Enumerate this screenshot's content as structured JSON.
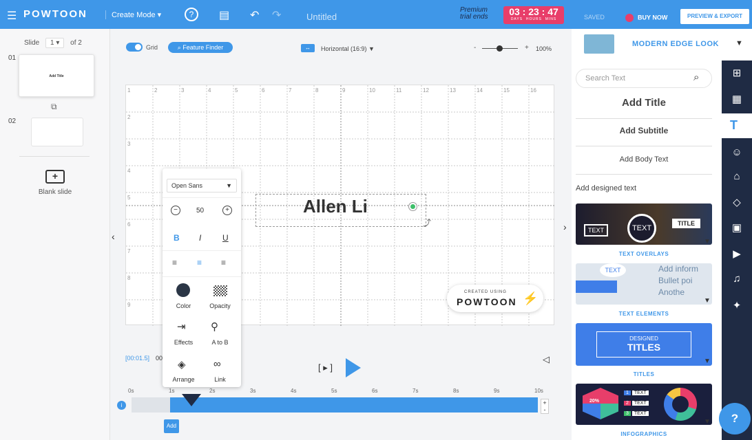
{
  "topbar": {
    "brand": "POWTOON",
    "mode_label": "Create Mode ▾",
    "doc_title": "Untitled",
    "premium_line1": "Premium",
    "premium_line2": "trial ends",
    "timer_value": "03 : 23 : 47",
    "timer_days": "DAYS",
    "timer_hours": "HOURS",
    "timer_mins": "MINS",
    "saved_label": "SAVED",
    "buy_label": "BUY NOW",
    "export_label": "PREVIEW & EXPORT"
  },
  "toolbar": {
    "grid_label": "Grid",
    "feature_finder": "Feature Finder",
    "orientation": "Horizontal (16:9)",
    "zoom": "100%",
    "zoom_minus": "-",
    "zoom_plus": "+"
  },
  "slides": {
    "slide_label": "Slide",
    "current": "1 ▾",
    "of_total": "of 2",
    "items": [
      {
        "num": "01",
        "title": "Add Title"
      },
      {
        "num": "02",
        "title": ""
      }
    ],
    "blank_label": "Blank slide"
  },
  "canvas": {
    "main_text": "Allen Li",
    "watermark_small": "CREATED USING",
    "watermark_big": "POWTOON",
    "grid_cols": [
      "1",
      "2",
      "3",
      "4",
      "5",
      "6",
      "7",
      "8",
      "9",
      "10",
      "11",
      "12",
      "13",
      "14",
      "15",
      "16"
    ],
    "grid_rows": [
      "2",
      "3",
      "4",
      "5",
      "6",
      "7",
      "8",
      "9"
    ]
  },
  "textpanel": {
    "font": "Open Sans",
    "font_size": "50",
    "bold": "B",
    "italic": "I",
    "underline": "U",
    "tools": [
      "Color",
      "Opacity",
      "Effects",
      "A to B",
      "Arrange",
      "Link"
    ]
  },
  "timeline": {
    "time_display": "[00:01.5]",
    "time_suffix": "00",
    "ticks": [
      "0s",
      "1s",
      "2s",
      "3s",
      "4s",
      "5s",
      "6s",
      "7s",
      "8s",
      "9s",
      "10s"
    ],
    "add_label": "Add",
    "plus": "+",
    "minus": "-"
  },
  "rightpanel": {
    "look_title": "MODERN EDGE LOOK",
    "search_placeholder": "Search Text",
    "add_title": "Add Title",
    "add_subtitle": "Add Subtitle",
    "add_body": "Add Body Text",
    "designed_header": "Add designed text",
    "cards": [
      {
        "label": "TEXT OVERLAYS",
        "color": "#1c1c2e"
      },
      {
        "label": "TEXT ELEMENTS",
        "color": "#dfe6ee"
      },
      {
        "label": "TITLES",
        "color": "#3f7ee8"
      },
      {
        "label": "INFOGRAPHICS",
        "color": "#1a1f3d"
      }
    ],
    "card_texts": {
      "overlay_a": "TEXT",
      "overlay_b": "TEXT",
      "overlay_c": "TITLE",
      "elements_bubble": "TEXT",
      "elements_lines": [
        "Add inform",
        "Bullet poi",
        "Anothe"
      ],
      "titles_small": "DESIGNED",
      "titles_big": "TITLES",
      "info_items": [
        "TEXT",
        "TEXT",
        "TEXT"
      ],
      "info_pct": "20%"
    }
  },
  "help_label": "?"
}
